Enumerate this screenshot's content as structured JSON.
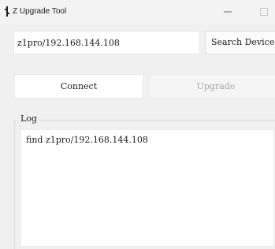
{
  "window": {
    "title": "Z Upgrade Tool",
    "app_icon": "app-icon",
    "controls": {
      "minimize": "minimize-icon",
      "maximize": "maximize-icon",
      "close": "close-icon"
    }
  },
  "search": {
    "address_value": "z1pro/192.168.144.108",
    "button_label": "Search Device"
  },
  "actions": {
    "connect_label": "Connect",
    "upgrade_label": "Upgrade",
    "upgrade_enabled": false
  },
  "log": {
    "title": "Log",
    "text": "find z1pro/192.168.144.108"
  },
  "colors": {
    "window_bg": "#f0f0f0",
    "disabled_text": "#a5a5a5",
    "field_bg": "#ffffff"
  }
}
